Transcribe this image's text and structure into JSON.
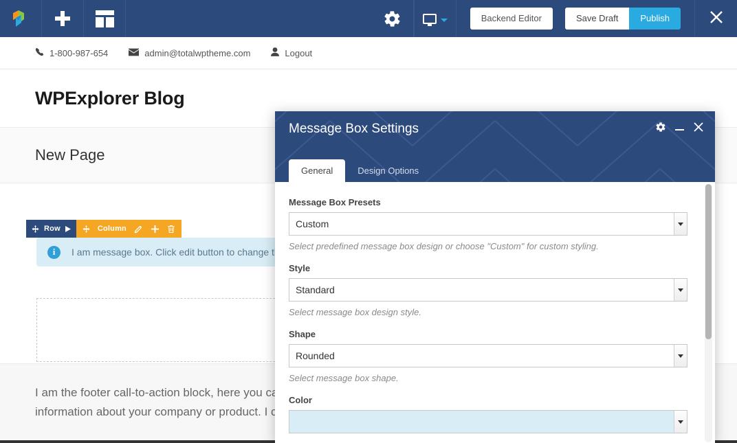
{
  "admin_bar": {
    "logo_icon": "wpbakery-logo-icon",
    "add_element_icon": "plus-icon",
    "templates_icon": "layout-grid-icon",
    "settings_icon": "gear-icon",
    "responsive_icon": "monitor-icon",
    "responsive_caret_icon": "caret-down-icon",
    "backend_editor_label": "Backend Editor",
    "save_draft_label": "Save Draft",
    "publish_label": "Publish",
    "close_icon": "close-x-icon"
  },
  "info_bar": {
    "phone_icon": "phone-icon",
    "phone": "1-800-987-654",
    "email_icon": "envelope-icon",
    "email": "admin@totalwptheme.com",
    "user_icon": "user-icon",
    "logout_label": "Logout"
  },
  "site": {
    "title": "WPExplorer Blog",
    "page_title": "New Page"
  },
  "editor": {
    "row_label": "Row",
    "row_move_icon": "move-arrows-icon",
    "row_expand_icon": "caret-right-icon",
    "column_label": "Column",
    "column_move_icon": "move-arrows-icon",
    "column_edit_icon": "pencil-icon",
    "column_add_icon": "plus-icon",
    "column_delete_icon": "trash-icon",
    "message_box_icon": "info-circle-icon",
    "message_box_icon_glyph": "i",
    "message_box_text": "I am message box. Click edit button to change this text."
  },
  "footer": {
    "cta_line1": "I am the footer call-to-action block, here you can add some relevant/useful",
    "cta_line2": "information about your company or product. I can be disabled in the Customizer."
  },
  "modal": {
    "title": "Message Box Settings",
    "gear_icon": "gear-icon",
    "minimize_icon": "minimize-icon",
    "close_icon": "close-x-icon",
    "tabs": [
      {
        "label": "General",
        "active": true
      },
      {
        "label": "Design Options",
        "active": false
      }
    ],
    "fields": [
      {
        "label": "Message Box Presets",
        "value": "Custom",
        "help": "Select predefined message box design or choose \"Custom\" for custom styling."
      },
      {
        "label": "Style",
        "value": "Standard",
        "help": "Select message box design style."
      },
      {
        "label": "Shape",
        "value": "Rounded",
        "help": "Select message box shape."
      },
      {
        "label": "Color",
        "value": "",
        "help": ""
      }
    ]
  },
  "colors": {
    "admin_blue": "#2c4a7c",
    "publish_cyan": "#29abe2",
    "column_orange": "#f5a623",
    "info_box_blue": "#d9edf7",
    "info_icon_blue": "#31a0d8"
  }
}
